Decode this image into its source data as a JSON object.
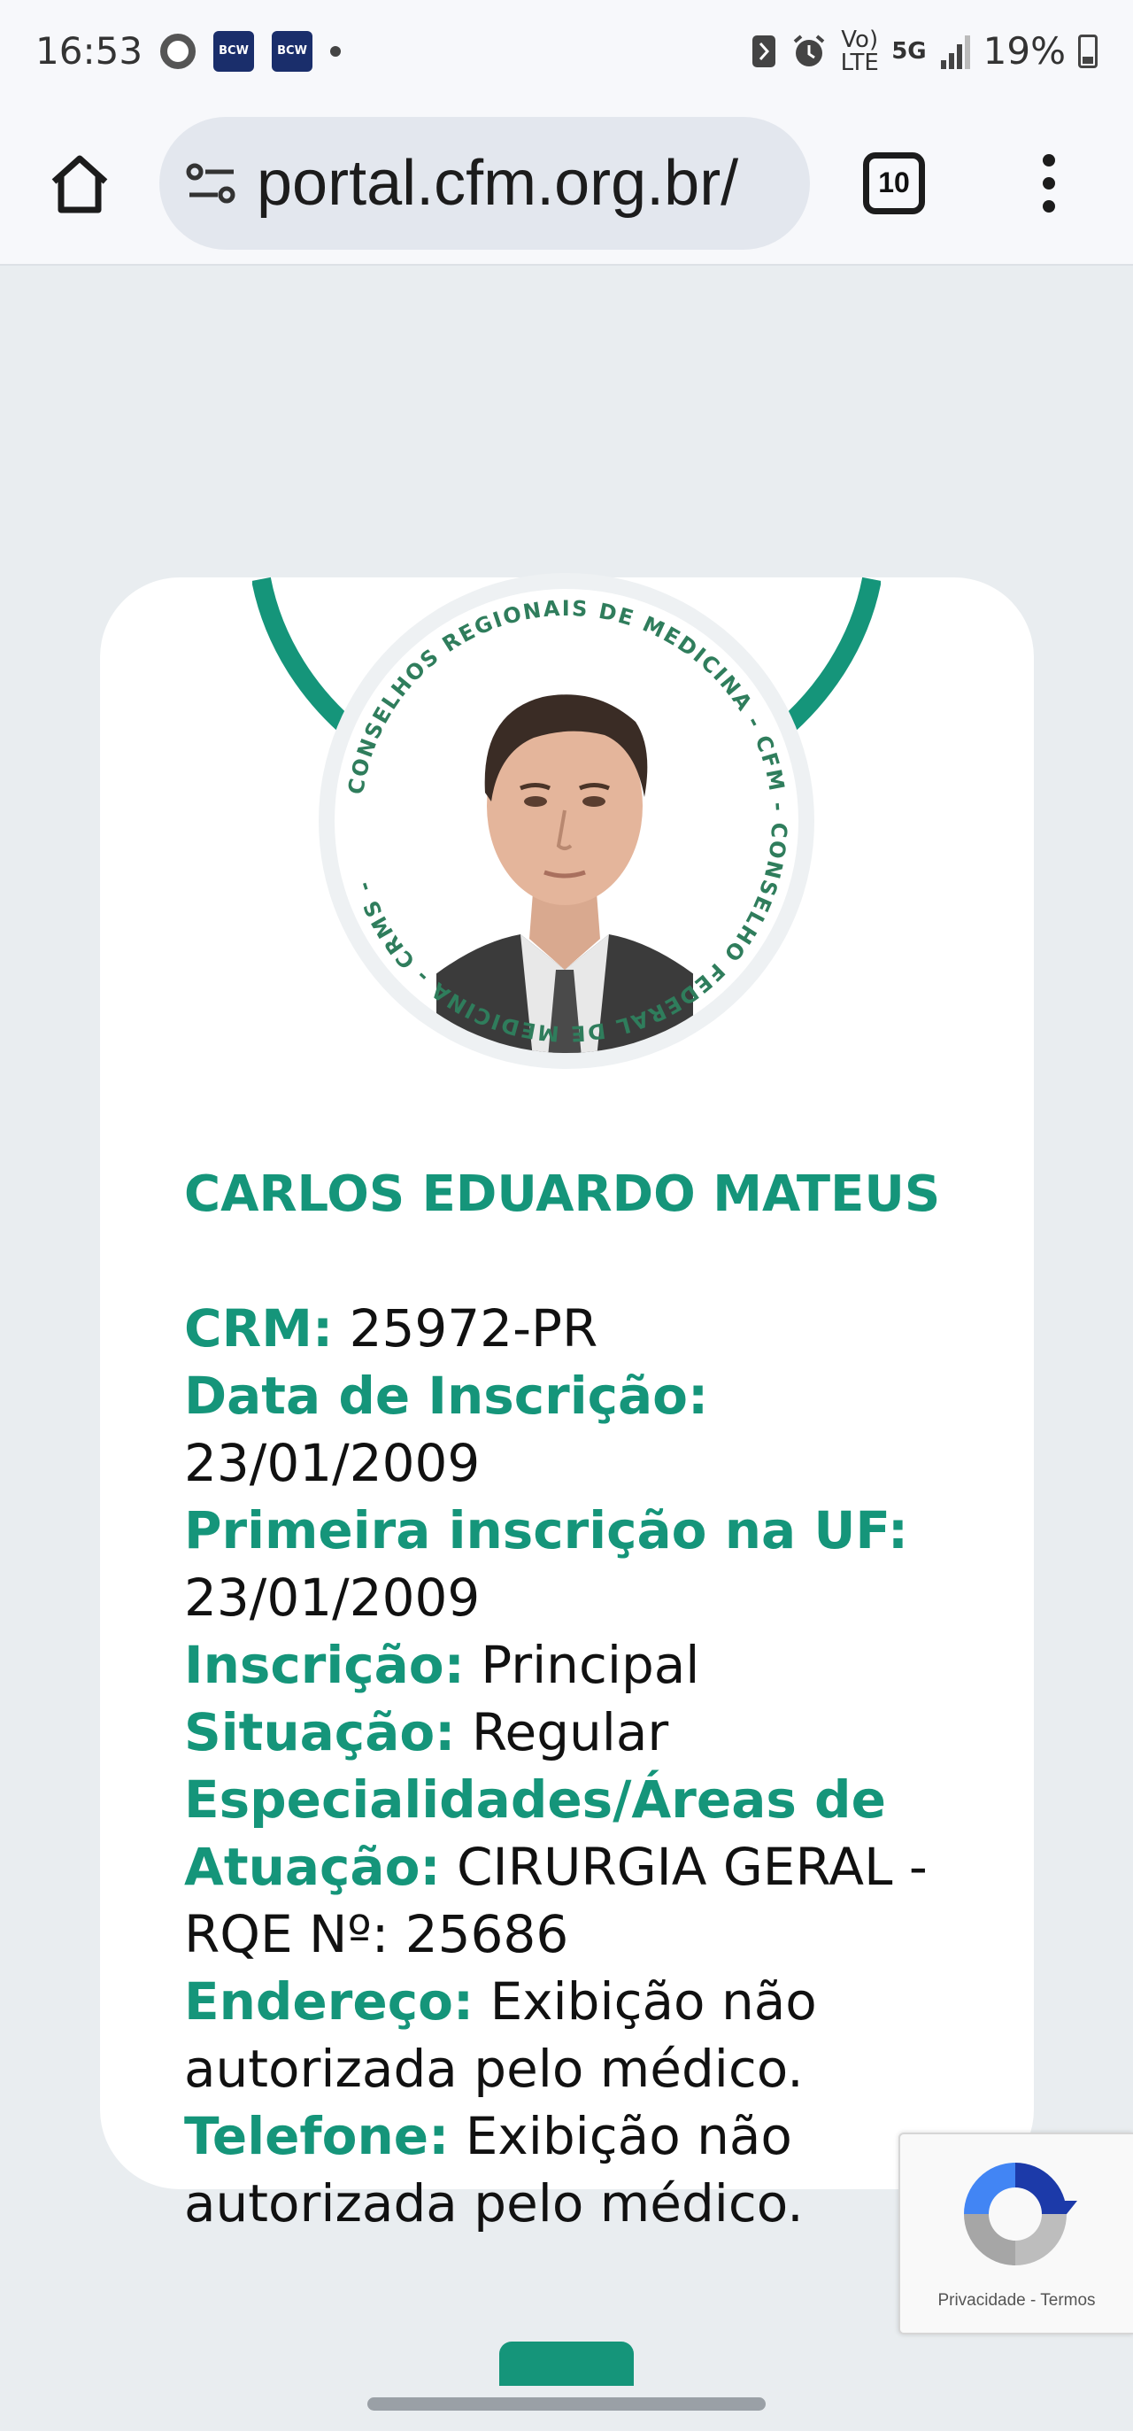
{
  "status_bar": {
    "time": "16:53",
    "bcw_label": "BCW",
    "network": "5G",
    "volte": "Vo) LTE",
    "battery": "19%",
    "icons": [
      "chrome-icon",
      "bcw-icon",
      "bcw-icon",
      "dot-icon",
      "nfc-icon",
      "alarm-icon",
      "volte-icon",
      "network-5g-icon",
      "signal-icon",
      "battery-icon"
    ]
  },
  "browser": {
    "url": "portal.cfm.org.br/",
    "tab_count": "10",
    "icons": [
      "home-icon",
      "site-settings-icon",
      "tabs-icon",
      "more-menu-icon"
    ]
  },
  "seal": {
    "ring_text": "CONSELHOS REGIONAIS DE MEDICINA - CFM - CONSELHO FEDERAL DE MEDICINA - CRMS -"
  },
  "doctor": {
    "name": "CARLOS EDUARDO MATEUS",
    "fields": [
      {
        "label": "CRM:",
        "value": "25972-PR"
      },
      {
        "label": "Data de Inscrição:",
        "value": "23/01/2009"
      },
      {
        "label": "Primeira inscrição na UF:",
        "value": "23/01/2009"
      },
      {
        "label": "Inscrição:",
        "value": "Principal"
      },
      {
        "label": "Situação:",
        "value": "Regular"
      },
      {
        "label": "Especialidades/Áreas de Atuação:",
        "value": "CIRURGIA GERAL - RQE Nº: 25686"
      },
      {
        "label": "Endereço:",
        "value": "Exibição não autorizada pelo médico."
      },
      {
        "label": "Telefone:",
        "value": "Exibição não autorizada pelo médico."
      }
    ]
  },
  "recaptcha": {
    "privacy": "Privacidade",
    "separator": "-",
    "terms": "Termos"
  },
  "colors": {
    "accent": "#15957a",
    "page_bg": "#e9edf0",
    "card_bg": "#ffffff"
  }
}
